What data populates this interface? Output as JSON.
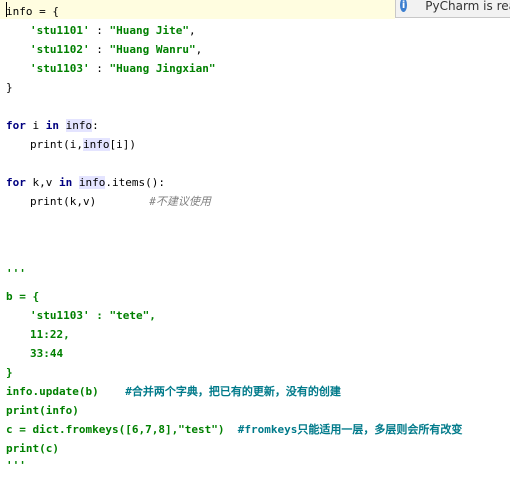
{
  "notification": {
    "text": "PyCharm is rea"
  },
  "code": {
    "l1_a": "info",
    "l1_b": " = {",
    "l2_s1": "'stu1101'",
    "l2_p": " : ",
    "l2_s2": "\"Huang Jite\"",
    "l2_c": ",",
    "l3_s1": "'stu1102'",
    "l3_p": " : ",
    "l3_s2": "\"Huang Wanru\"",
    "l3_c": ",",
    "l4_s1": "'stu1103'",
    "l4_p": " : ",
    "l4_s2": "\"Huang Jingxian\"",
    "l5": "}",
    "l6_kw1": "for",
    "l6_var": " i ",
    "l6_kw2": "in",
    "l6_sp": " ",
    "l6_obj": "info",
    "l6_end": ":",
    "l7_fn": "print",
    "l7_a": "(i,",
    "l7_obj": "info",
    "l7_b": "[i])",
    "l8_kw1": "for",
    "l8_var": " k,v ",
    "l8_kw2": "in",
    "l8_sp": " ",
    "l8_obj": "info",
    "l8_end": ".items():",
    "l9_fn": "print",
    "l9_a": "(k,v)",
    "l9_sp": "        ",
    "l9_cmt": "#不建议使用",
    "l10": "'''",
    "l11_a": "b = {",
    "l12_s1": "'stu1103'",
    "l12_p": " : ",
    "l12_s2": "\"tete\"",
    "l12_c": ",",
    "l13": "11:22,",
    "l14": "33:44",
    "l15": "}",
    "l16_code": "info.update(b)",
    "l16_sp": "    ",
    "l16_cmt": "#合并两个字典，把已有的更新，没有的创建",
    "l17": "print(info)",
    "l18_code": "c = dict.fromkeys([6,7,8],\"test\")",
    "l18_sp": "  ",
    "l18_cmt": "#fromkeys只能适用一层，多层则会所有改变",
    "l19": "print(c)",
    "l20": "'''"
  }
}
